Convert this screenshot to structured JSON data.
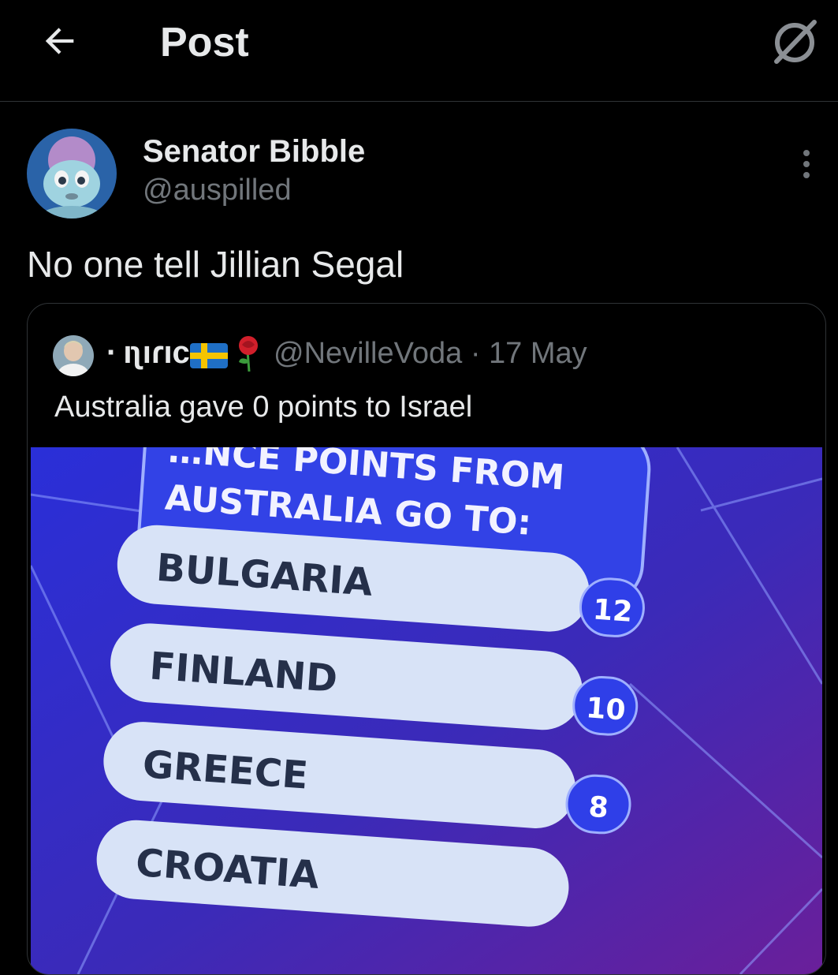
{
  "header": {
    "title": "Post"
  },
  "post": {
    "display_name": "Senator Bibble",
    "handle": "@auspilled",
    "text": "No one tell Jillian Segal"
  },
  "quote": {
    "display_name": "· ıʅıɾıc",
    "handle_and_date": "@NevilleVoda · 17 May",
    "text": "Australia gave 0 points to Israel"
  },
  "media": {
    "header_line1": "…NCE POINTS FROM",
    "header_line2": "AUSTRALIA GO TO:",
    "results": [
      {
        "country": "BULGARIA",
        "points": "12"
      },
      {
        "country": "FINLAND",
        "points": "10"
      },
      {
        "country": "GREECE",
        "points": "8"
      },
      {
        "country": "CROATIA",
        "points": ""
      }
    ]
  },
  "colors": {
    "background": "#000000",
    "text": "#e7e9ea",
    "secondary": "#71767b",
    "border": "#2f3336",
    "tv_blue": "#2f3fe8"
  }
}
